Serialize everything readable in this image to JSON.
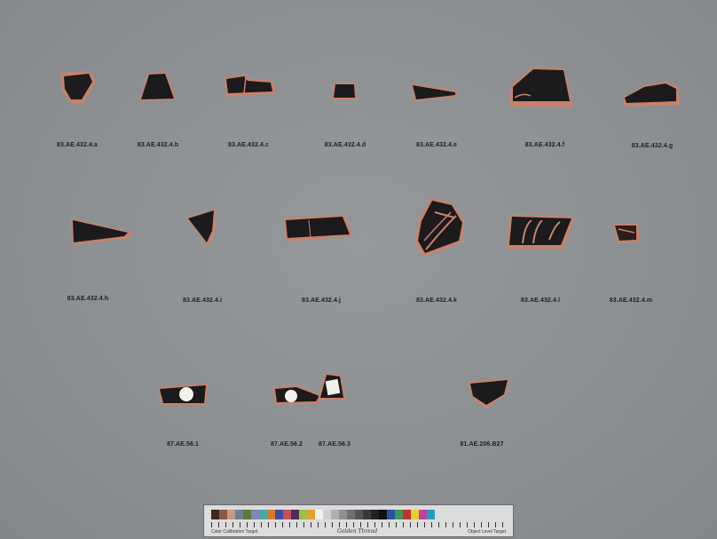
{
  "labels": {
    "a": "83.AE.432.4.a",
    "b": "83.AE.432.4.b",
    "c": "83.AE.432.4.c",
    "d": "83.AE.432.4.d",
    "e": "83.AE.432.4.e",
    "f": "83.AE.432.4.f",
    "g": "83.AE.432.4.g",
    "h": "83.AE.432.4.h",
    "i": "83.AE.432.4.i",
    "j": "83.AE.432.4.j",
    "k": "83.AE.432.4.k",
    "l": "83.AE.432.4.l",
    "m": "83.AE.432.4.m",
    "s1": "87.AE.56.1",
    "s2": "87.AE.56.2",
    "s3": "87.AE.56.3",
    "b27": "81.AE.206.B27"
  },
  "color_bar": {
    "maker_text": "Golden Thread",
    "left_text": "Color Calibration Target",
    "right_text": "Object Level Target",
    "swatch_colors": [
      "#3b2a22",
      "#8a5a44",
      "#c89a80",
      "#6a7f95",
      "#5c7a3c",
      "#7f88b8",
      "#47a9a8",
      "#d97a2a",
      "#3b4e9e",
      "#c8505a",
      "#4a2e5c",
      "#a0c040",
      "#e8a030",
      "#f2f2f2",
      "#cfcfcf",
      "#b0b0b0",
      "#909090",
      "#707070",
      "#555555",
      "#3a3a3a",
      "#222222",
      "#111111",
      "#2a50a0",
      "#3a9a50",
      "#c03030",
      "#e8d030",
      "#c040a0",
      "#20a0c0"
    ]
  },
  "colors": {
    "background": "#8c8f92",
    "glaze": "#1b1a1c",
    "clay": "#c8826a"
  }
}
